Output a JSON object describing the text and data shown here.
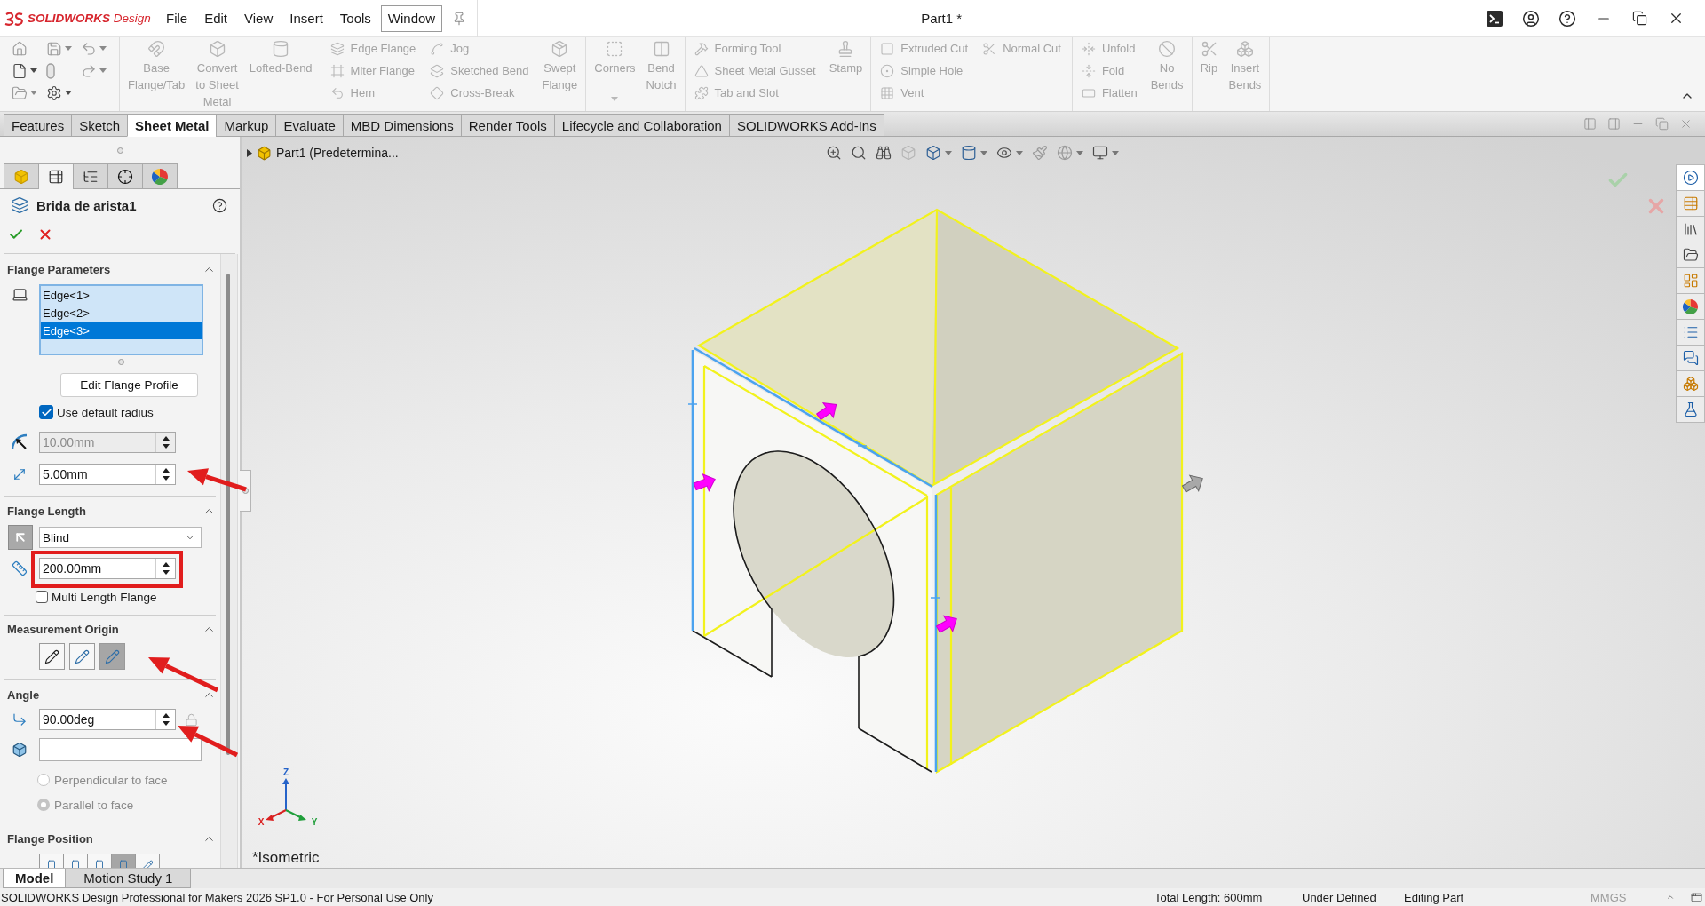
{
  "title_bar": {
    "logo": "**SOLIDWORKS** Design",
    "menu": [
      {
        "label": "File",
        "selected": false
      },
      {
        "label": "Edit",
        "selected": false
      },
      {
        "label": "View",
        "selected": false
      },
      {
        "label": "Insert",
        "selected": false
      },
      {
        "label": "Tools",
        "selected": false
      },
      {
        "label": "Window",
        "selected": true
      }
    ],
    "document_title": "Part1 *"
  },
  "ribbon": {
    "disabled": true,
    "groups": [
      {
        "columns": [
          {
            "kind": "large",
            "label": "Base\nFlange/Tab"
          },
          {
            "kind": "large",
            "label": "Convert\nto Sheet\nMetal"
          },
          {
            "kind": "large",
            "label": "Lofted-Bend"
          }
        ]
      },
      {
        "columns": [
          {
            "kind": "stack",
            "items": [
              "Edge Flange",
              "Miter Flange",
              "Hem"
            ]
          },
          {
            "kind": "stack",
            "items": [
              "Jog",
              "Sketched Bend",
              "Cross-Break"
            ]
          },
          {
            "kind": "large",
            "label": "Swept\nFlange"
          }
        ]
      },
      {
        "columns": [
          {
            "kind": "large_menu",
            "label": "Corners"
          },
          {
            "kind": "large",
            "label": "Bend\nNotch"
          }
        ]
      },
      {
        "columns": [
          {
            "kind": "stack",
            "items": [
              "Forming Tool",
              "Sheet Metal Gusset",
              "Tab and Slot"
            ]
          },
          {
            "kind": "large",
            "label": "Stamp"
          }
        ]
      },
      {
        "columns": [
          {
            "kind": "stack",
            "items": [
              "Extruded Cut",
              "Simple Hole",
              "Vent"
            ]
          },
          {
            "kind": "stack",
            "items": [
              "Normal Cut"
            ]
          }
        ]
      },
      {
        "columns": [
          {
            "kind": "stack",
            "items": [
              "Unfold",
              "Fold",
              "Flatten"
            ]
          },
          {
            "kind": "large",
            "label": "No\nBends"
          }
        ]
      },
      {
        "columns": [
          {
            "kind": "large",
            "label": "Rip"
          },
          {
            "kind": "large",
            "label": "Insert\nBends"
          }
        ]
      }
    ]
  },
  "command_tabs": [
    {
      "label": "Features",
      "selected": false
    },
    {
      "label": "Sketch",
      "selected": false
    },
    {
      "label": "Sheet Metal",
      "selected": true
    },
    {
      "label": "Markup",
      "selected": false
    },
    {
      "label": "Evaluate",
      "selected": false
    },
    {
      "label": "MBD Dimensions",
      "selected": false
    },
    {
      "label": "Render Tools",
      "selected": false
    },
    {
      "label": "Lifecycle and Collaboration",
      "selected": false
    },
    {
      "label": "SOLIDWORKS Add-Ins",
      "selected": false
    }
  ],
  "property_manager": {
    "manager_tabs": [
      {
        "selected": false
      },
      {
        "selected": true
      },
      {
        "selected": false
      },
      {
        "selected": false
      },
      {
        "selected": false
      }
    ],
    "title": "Brida de arista1",
    "flange_parameters": {
      "heading": "Flange Parameters",
      "expanded": true,
      "edges": [
        {
          "label": "Edge<1>",
          "selected": false
        },
        {
          "label": "Edge<2>",
          "selected": false
        },
        {
          "label": "Edge<3>",
          "selected": true
        }
      ],
      "edit_button": "Edit Flange Profile",
      "use_default_radius": {
        "label": "Use default radius",
        "checked": true
      },
      "bend_radius": {
        "value": "10.00mm",
        "disabled": true
      },
      "gap": {
        "value": "5.00mm",
        "disabled": false
      }
    },
    "flange_length": {
      "heading": "Flange Length",
      "expanded": true,
      "end_condition": "Blind",
      "length": {
        "value": "200.00mm",
        "disabled": false
      },
      "multi_length": {
        "label": "Multi Length Flange",
        "checked": false
      }
    },
    "measurement_origin": {
      "heading": "Measurement Origin",
      "expanded": true,
      "options": [
        {
          "selected": false
        },
        {
          "selected": false
        },
        {
          "selected": true
        }
      ]
    },
    "angle": {
      "heading": "Angle",
      "expanded": true,
      "angle": {
        "value": "90.00deg",
        "disabled": false
      },
      "orientation": [
        {
          "label": "Perpendicular to face",
          "selected": false,
          "disabled": true
        },
        {
          "label": "Parallel to face",
          "selected": true,
          "disabled": true
        }
      ]
    },
    "flange_position": {
      "heading": "Flange Position",
      "expanded": true,
      "options": [
        {
          "selected": false
        },
        {
          "selected": false
        },
        {
          "selected": false
        },
        {
          "selected": true
        },
        {
          "selected": false
        }
      ]
    }
  },
  "viewport": {
    "breadcrumb": "Part1 (Predetermina...",
    "triad": {
      "x": "X",
      "y": "Y",
      "z": "Z"
    },
    "view_name": "*Isometric"
  },
  "task_pane": {
    "tabs": [
      {
        "selected": true
      },
      {
        "selected": false
      },
      {
        "selected": false
      },
      {
        "selected": false
      },
      {
        "selected": false
      },
      {
        "selected": false
      },
      {
        "selected": false
      },
      {
        "selected": false
      },
      {
        "selected": false
      },
      {
        "selected": false
      }
    ]
  },
  "bottom_tabs": [
    {
      "label": "Model",
      "selected": true
    },
    {
      "label": "Motion Study 1",
      "selected": false
    }
  ],
  "status_bar": {
    "product": "SOLIDWORKS Design Professional for Makers 2026 SP1.0 - For Personal Use Only",
    "fields": [
      "Total Length: 600mm",
      "Under Defined",
      "Editing Part"
    ],
    "units": "MMGS"
  }
}
